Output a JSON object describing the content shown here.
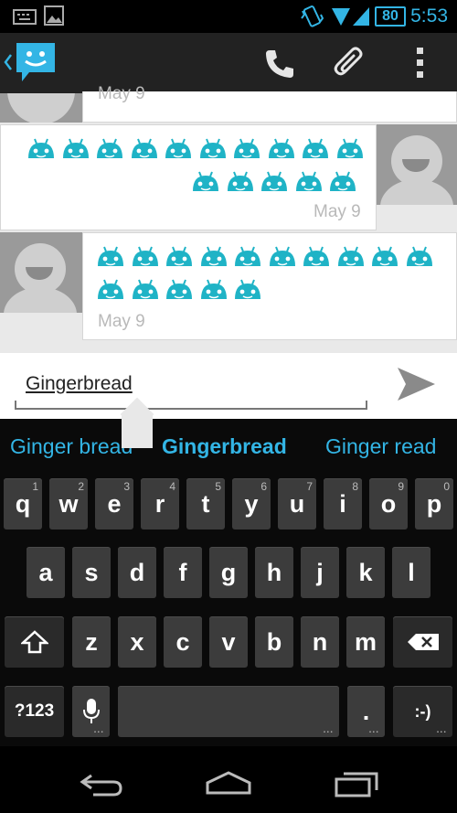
{
  "status_bar": {
    "time": "5:53",
    "battery": "80",
    "icons": [
      "keyboard-icon",
      "image-icon",
      "vibrate-icon",
      "wifi-icon",
      "signal-icon",
      "battery-icon"
    ]
  },
  "action_bar": {
    "icons": [
      "back-chevron-icon",
      "messaging-app-icon",
      "phone-icon",
      "paperclip-icon",
      "overflow-menu-icon"
    ]
  },
  "messages": [
    {
      "direction": "incoming",
      "date": "May 9",
      "emoji_count": 0
    },
    {
      "direction": "outgoing",
      "date": "May 9",
      "emoji_count": 15
    },
    {
      "direction": "incoming",
      "date": "May 9",
      "emoji_count": 15
    }
  ],
  "compose": {
    "text": "Gingerbread",
    "send_icon": "send-icon"
  },
  "suggestions": [
    "Ginger bread",
    "Gingerbread",
    "Ginger read"
  ],
  "keyboard": {
    "row1": [
      {
        "label": "q",
        "hint": "1"
      },
      {
        "label": "w",
        "hint": "2"
      },
      {
        "label": "e",
        "hint": "3"
      },
      {
        "label": "r",
        "hint": "4"
      },
      {
        "label": "t",
        "hint": "5"
      },
      {
        "label": "y",
        "hint": "6"
      },
      {
        "label": "u",
        "hint": "7"
      },
      {
        "label": "i",
        "hint": "8"
      },
      {
        "label": "o",
        "hint": "9"
      },
      {
        "label": "p",
        "hint": "0"
      }
    ],
    "row2": [
      "a",
      "s",
      "d",
      "f",
      "g",
      "h",
      "j",
      "k",
      "l"
    ],
    "row3": [
      "z",
      "x",
      "c",
      "v",
      "b",
      "n",
      "m"
    ],
    "symbols_label": "?123",
    "period_label": ".",
    "smiley_label": ":-)"
  },
  "nav_bar": {
    "icons": [
      "back-icon",
      "home-icon",
      "recent-apps-icon"
    ]
  },
  "colors": {
    "accent": "#33b5e5",
    "emoji": "#1fb3c6"
  }
}
